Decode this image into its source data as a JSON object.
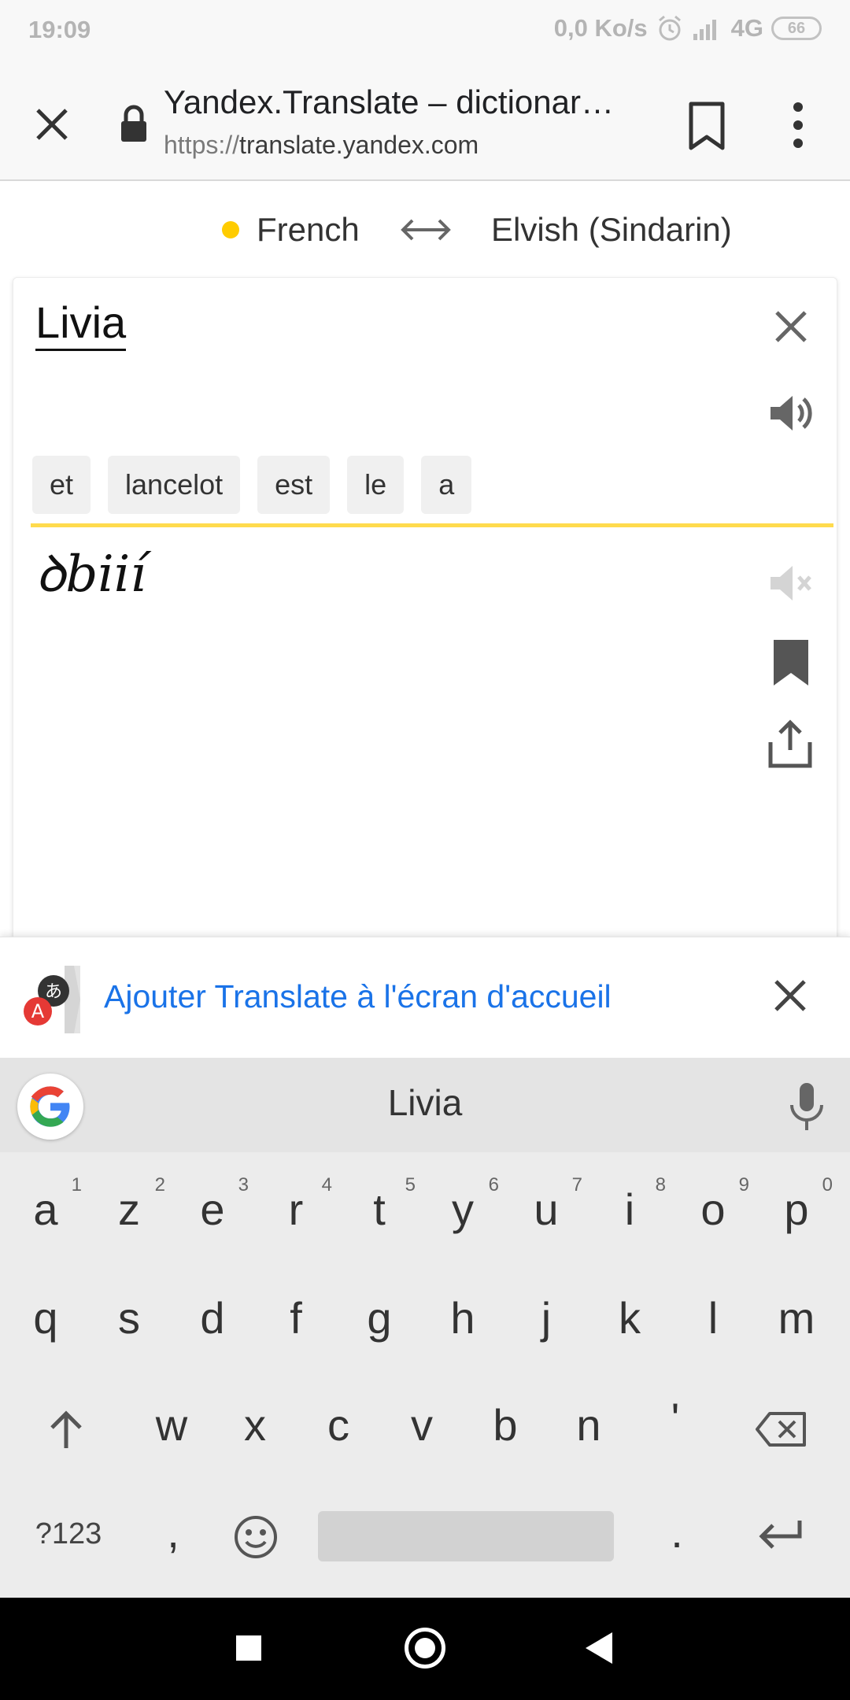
{
  "status_bar": {
    "time": "19:09",
    "net_speed": "0,0 Ko/s",
    "network": "4G",
    "battery": "66"
  },
  "browser": {
    "page_title": "Yandex.Translate – dictionar…",
    "url_scheme": "https://",
    "url_host": "translate.yandex.com"
  },
  "languages": {
    "source": "French",
    "target": "Elvish (Sindarin)"
  },
  "translator": {
    "input_text": "Livia",
    "suggestions": [
      "et",
      "lancelot",
      "est",
      "le",
      "a"
    ],
    "output_text": "ꝺbiií"
  },
  "banner": {
    "text": "Ajouter Translate à l'écran d'accueil"
  },
  "keyboard": {
    "suggestion": "Livia",
    "row1": [
      {
        "k": "a",
        "h": "1"
      },
      {
        "k": "z",
        "h": "2"
      },
      {
        "k": "e",
        "h": "3"
      },
      {
        "k": "r",
        "h": "4"
      },
      {
        "k": "t",
        "h": "5"
      },
      {
        "k": "y",
        "h": "6"
      },
      {
        "k": "u",
        "h": "7"
      },
      {
        "k": "i",
        "h": "8"
      },
      {
        "k": "o",
        "h": "9"
      },
      {
        "k": "p",
        "h": "0"
      }
    ],
    "row2": [
      "q",
      "s",
      "d",
      "f",
      "g",
      "h",
      "j",
      "k",
      "l",
      "m"
    ],
    "row3": [
      "w",
      "x",
      "c",
      "v",
      "b",
      "n",
      "'"
    ],
    "symbols_key": "?123",
    "comma_key": ",",
    "period_key": "."
  },
  "colors": {
    "accent_yellow": "#ffdb4d",
    "link_blue": "#1a73e8",
    "lang_dot": "#ffcc00"
  }
}
